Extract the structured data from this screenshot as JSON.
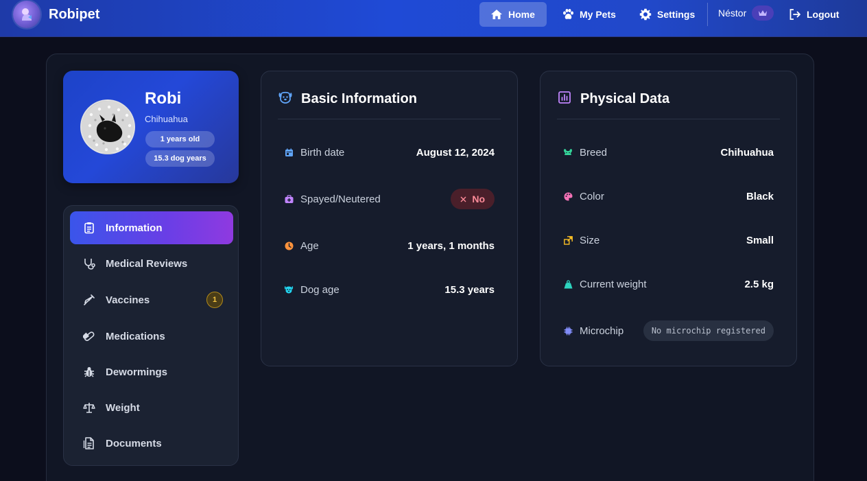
{
  "app": {
    "brand_name": "Robipet"
  },
  "nav": {
    "home": "Home",
    "my_pets": "My Pets",
    "settings": "Settings",
    "user_name": "Néstor",
    "logout": "Logout"
  },
  "profile": {
    "name": "Robi",
    "breed": "Chihuahua",
    "age_pill": "1 years old",
    "dog_years_pill": "15.3 dog years"
  },
  "menu": {
    "items": [
      {
        "label": "Information",
        "icon": "clipboard-icon",
        "active": true
      },
      {
        "label": "Medical Reviews",
        "icon": "stethoscope-icon"
      },
      {
        "label": "Vaccines",
        "icon": "syringe-icon",
        "badge": "1"
      },
      {
        "label": "Medications",
        "icon": "pill-icon"
      },
      {
        "label": "Dewormings",
        "icon": "bug-icon"
      },
      {
        "label": "Weight",
        "icon": "scale-icon"
      },
      {
        "label": "Documents",
        "icon": "document-icon"
      }
    ]
  },
  "basic_info": {
    "title": "Basic Information",
    "rows": [
      {
        "label": "Birth date",
        "value": "August 12, 2024",
        "icon": "calendar-icon",
        "color": "#60a5fa"
      },
      {
        "label": "Spayed/Neutered",
        "value": "No",
        "icon": "medical-bag-icon",
        "color": "#c084fc"
      },
      {
        "label": "Age",
        "value": "1 years, 1 months",
        "icon": "clock-icon",
        "color": "#fb923c"
      },
      {
        "label": "Dog age",
        "value": "15.3 years",
        "icon": "dog-face-icon",
        "color": "#22d3ee"
      }
    ]
  },
  "physical_data": {
    "title": "Physical Data",
    "rows": [
      {
        "label": "Breed",
        "value": "Chihuahua",
        "icon": "dna-icon",
        "color": "#34d399"
      },
      {
        "label": "Color",
        "value": "Black",
        "icon": "palette-icon",
        "color": "#f472b6"
      },
      {
        "label": "Size",
        "value": "Small",
        "icon": "resize-icon",
        "color": "#fbbf24"
      },
      {
        "label": "Current weight",
        "value": "2.5 kg",
        "icon": "weight-icon",
        "color": "#2dd4bf"
      },
      {
        "label": "Microchip",
        "value": "No microchip registered",
        "icon": "chip-icon",
        "color": "#818cf8"
      }
    ]
  },
  "colors": {
    "nav_gradient_start": "#1e3aa8",
    "accent_gradient_start": "#3a55ea",
    "accent_gradient_end": "#8f3ae0",
    "negative_badge": "#ff8c9a",
    "warning_badge": "#f5c542"
  }
}
